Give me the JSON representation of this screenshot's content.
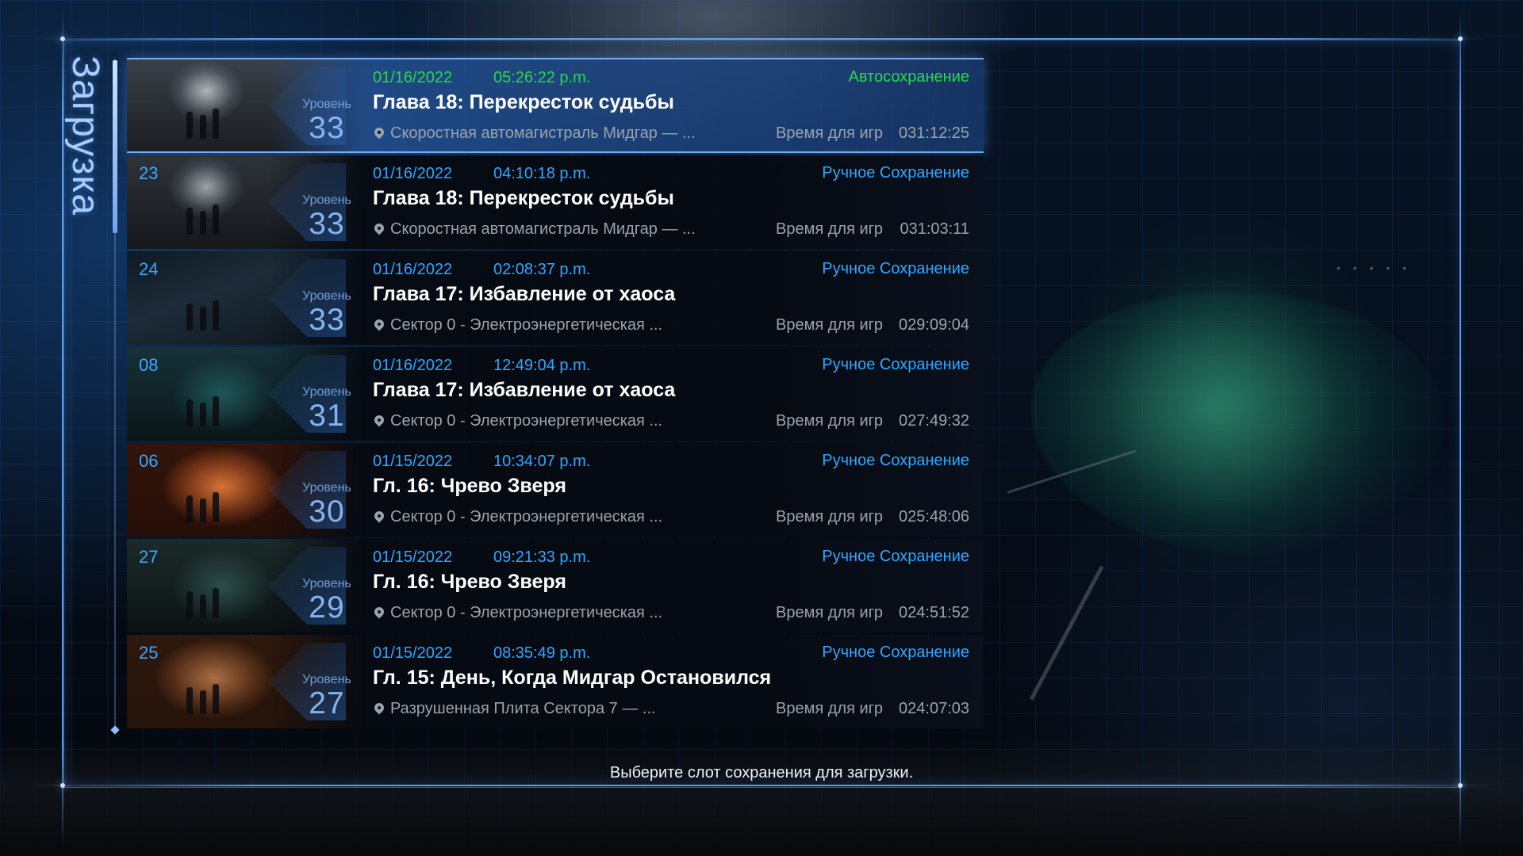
{
  "screen_title": "Загрузка",
  "footer_hint": "Выберите слот сохранения для загрузки.",
  "level_label": "Уровень",
  "playtime_label": "Время для игр",
  "colors": {
    "accent_blue": "#2fa8ff",
    "autosave_green": "#27d84a",
    "selected_bg": "#28589c",
    "frame": "#6ea8f5"
  },
  "icons": {
    "location": "location-pin-icon"
  },
  "saves": [
    {
      "slot": "",
      "date": "01/16/2022",
      "time": "05:26:22 p.m.",
      "type": "Автосохранение",
      "chapter": "Глава 18: Перекресток судьбы",
      "location": "Скоростная автомагистраль Мидгар — ...",
      "level": "33",
      "playtime": "031:12:25",
      "selected": true
    },
    {
      "slot": "23",
      "date": "01/16/2022",
      "time": "04:10:18 p.m.",
      "type": "Ручное Сохранение",
      "chapter": "Глава 18: Перекресток судьбы",
      "location": "Скоростная автомагистраль Мидгар — ...",
      "level": "33",
      "playtime": "031:03:11",
      "selected": false
    },
    {
      "slot": "24",
      "date": "01/16/2022",
      "time": "02:08:37 p.m.",
      "type": "Ручное Сохранение",
      "chapter": "Глава 17: Избавление от хаоса",
      "location": "Сектор 0 - Электроэнергетическая ...",
      "level": "33",
      "playtime": "029:09:04",
      "selected": false
    },
    {
      "slot": "08",
      "date": "01/16/2022",
      "time": "12:49:04 p.m.",
      "type": "Ручное Сохранение",
      "chapter": "Глава 17: Избавление от хаоса",
      "location": "Сектор 0 - Электроэнергетическая ...",
      "level": "31",
      "playtime": "027:49:32",
      "selected": false
    },
    {
      "slot": "06",
      "date": "01/15/2022",
      "time": "10:34:07 p.m.",
      "type": "Ручное Сохранение",
      "chapter": "Гл. 16: Чрево Зверя",
      "location": "Сектор 0 - Электроэнергетическая ...",
      "level": "30",
      "playtime": "025:48:06",
      "selected": false
    },
    {
      "slot": "27",
      "date": "01/15/2022",
      "time": "09:21:33 p.m.",
      "type": "Ручное Сохранение",
      "chapter": "Гл. 16: Чрево Зверя",
      "location": "Сектор 0 - Электроэнергетическая ...",
      "level": "29",
      "playtime": "024:51:52",
      "selected": false
    },
    {
      "slot": "25",
      "date": "01/15/2022",
      "time": "08:35:49 p.m.",
      "type": "Ручное Сохранение",
      "chapter": "Гл. 15: День, Когда Мидгар Остановился",
      "location": "Разрушенная Плита Сектора 7 — ...",
      "level": "27",
      "playtime": "024:07:03",
      "selected": false
    }
  ]
}
